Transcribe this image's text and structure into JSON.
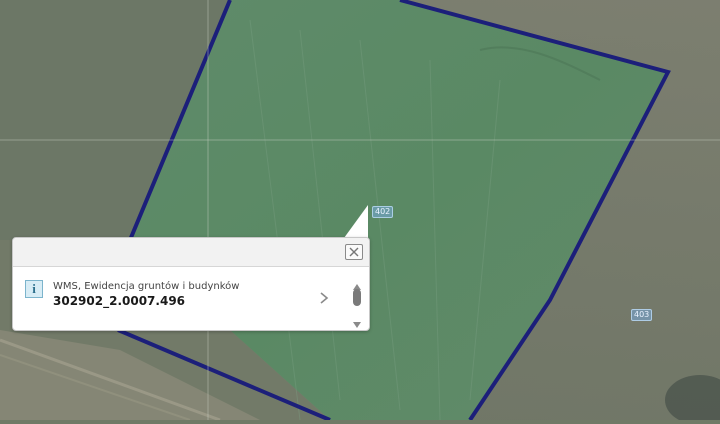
{
  "map": {
    "parcel_labels": [
      "402",
      "403"
    ]
  },
  "popup": {
    "info_icon": "i",
    "result": {
      "source": "WMS, Ewidencja gruntów i budynków",
      "value": "302902_2.0007.496"
    },
    "close_icon": "close-icon",
    "next_icon": "chevron-right-icon"
  },
  "colors": {
    "parcel_border": "#1c1f7a",
    "field": "#5e8a66",
    "popup_bg": "#ffffff"
  }
}
